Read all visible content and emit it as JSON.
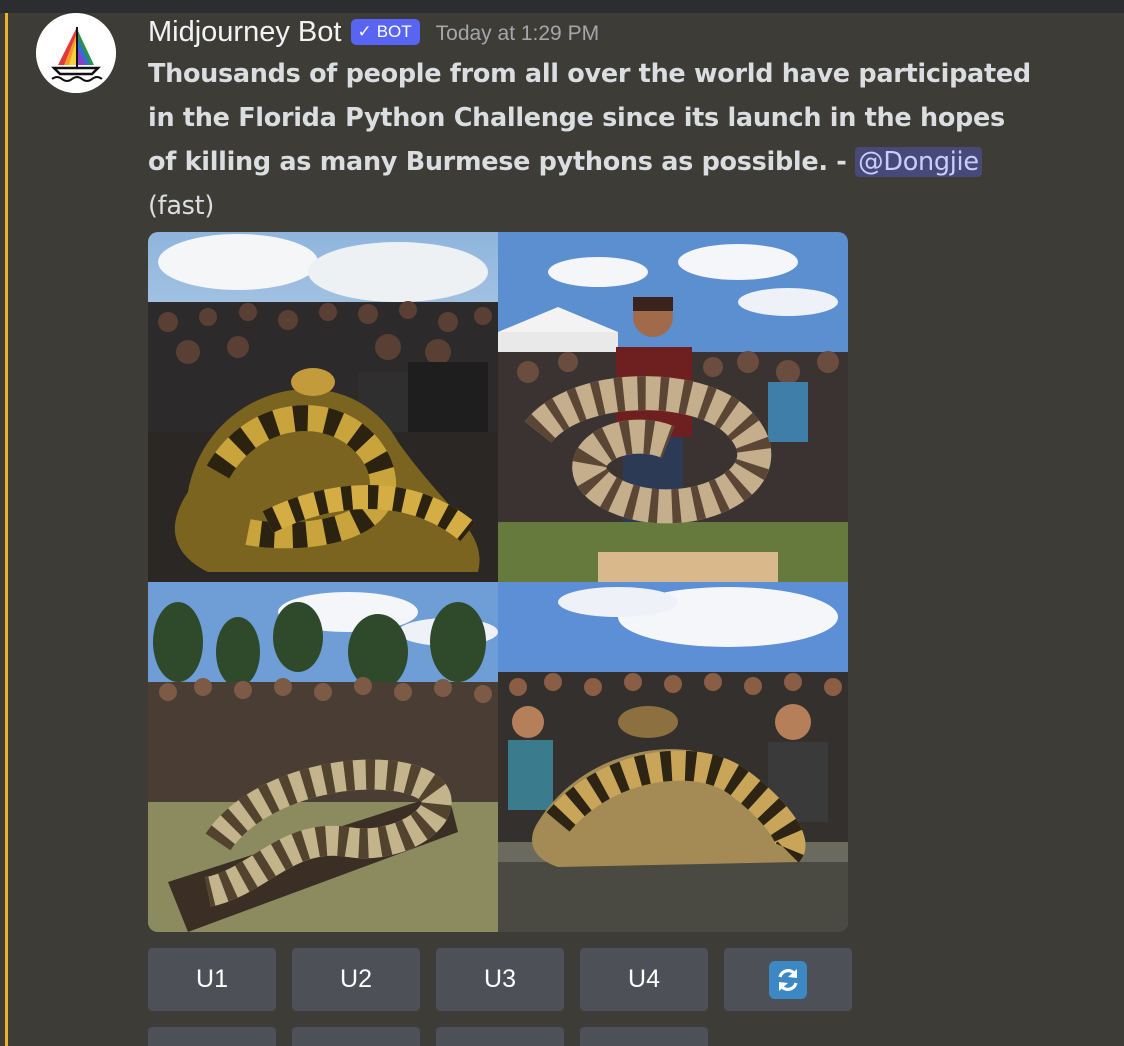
{
  "message": {
    "author": "Midjourney Bot",
    "bot_badge": "BOT",
    "timestamp": "Today at 1:29 PM",
    "prompt_lines": [
      "Thousands of people from all over the world have participated",
      "in the Florida Python Challenge since its launch in the hopes",
      "of killing as many Burmese pythons as possible. - "
    ],
    "mention": "@Dongjie",
    "mode": "(fast)"
  },
  "buttons": {
    "u1": "U1",
    "u2": "U2",
    "u3": "U3",
    "u4": "U4",
    "reroll_icon": "refresh-icon"
  },
  "colors": {
    "background": "#3e3c37",
    "highlight": "#f0b132",
    "bot_badge": "#5865f2",
    "button": "#4e5058",
    "mention_text": "#c9cdfb"
  }
}
